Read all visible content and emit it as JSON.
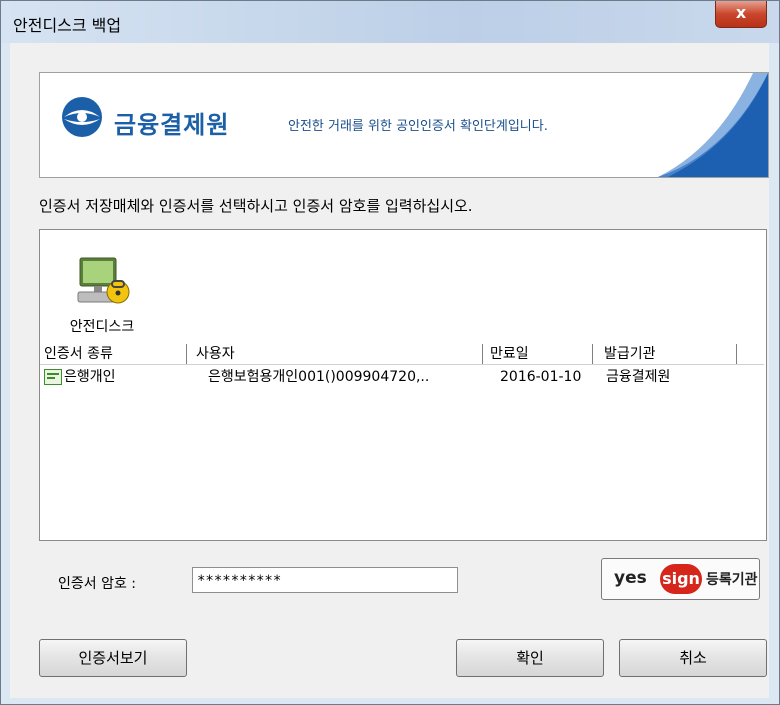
{
  "window": {
    "title": "안전디스크 백업",
    "close_label": "x"
  },
  "banner": {
    "logo_text": "금융결제원",
    "subtitle": "안전한 거래를 위한 공인인증서 확인단계입니다."
  },
  "instruction": "인증서 저장매체와 인증서를 선택하시고 인증서 암호를 입력하십시오.",
  "media": {
    "icon": "secure-disk-computer-lock-icon",
    "label": "안전디스크"
  },
  "cert_table": {
    "headers": [
      "인증서 종류",
      "사용자",
      "만료일",
      "발급기관"
    ],
    "rows": [
      {
        "type": "은행개인",
        "user": "은행보험용개인001()009904720,..",
        "expiry": "2016-01-10",
        "issuer": "금융결제원"
      }
    ]
  },
  "password": {
    "label": "인증서 암호 :",
    "value": "**********"
  },
  "yessign": {
    "yes": "yes",
    "sign": "sign",
    "reg": "등록기관"
  },
  "buttons": {
    "view_cert": "인증서보기",
    "ok": "확인",
    "cancel": "취소"
  },
  "colors": {
    "brand_blue": "#1b5fa8",
    "close_red": "#c9452b",
    "yessign_red": "#d6261c"
  }
}
